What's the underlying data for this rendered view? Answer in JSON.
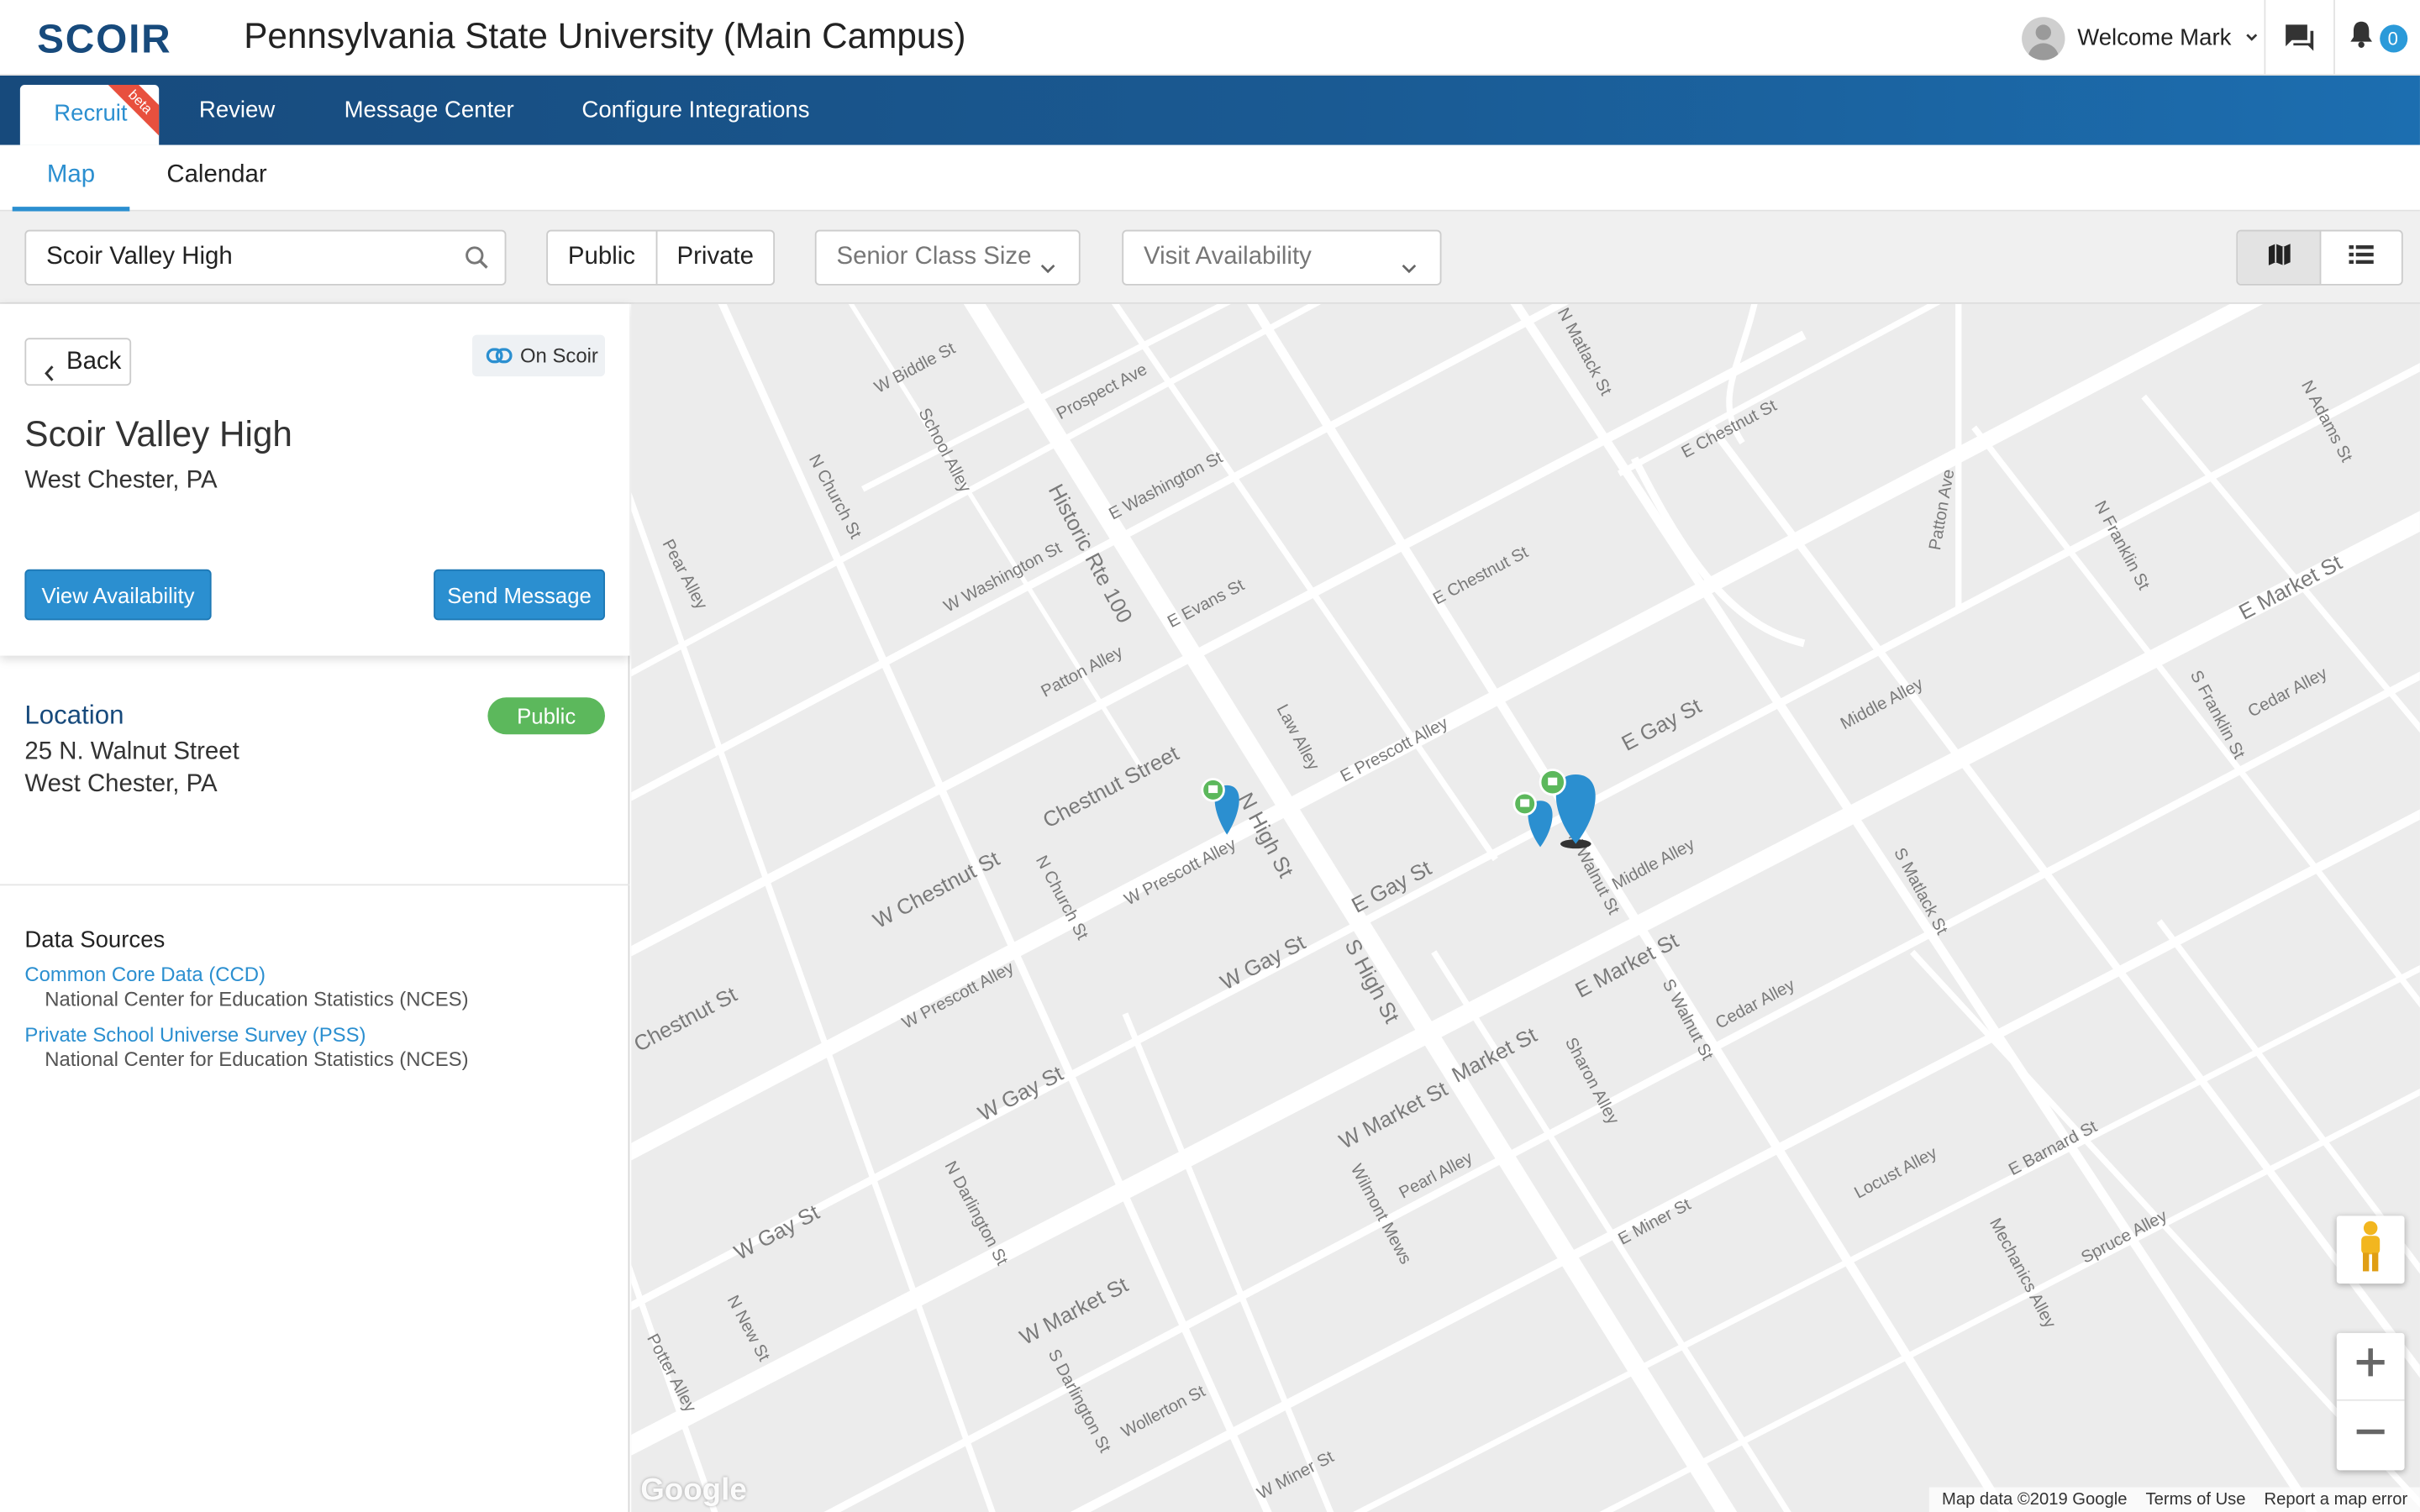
{
  "header": {
    "logo": "SCOIR",
    "institution": "Pennsylvania State University (Main Campus)",
    "welcome": "Welcome Mark",
    "notification_count": "0"
  },
  "nav": {
    "tabs": [
      {
        "label": "Recruit",
        "badge": "beta",
        "active": true
      },
      {
        "label": "Review"
      },
      {
        "label": "Message Center"
      },
      {
        "label": "Configure Integrations"
      }
    ]
  },
  "subnav": {
    "tabs": [
      {
        "label": "Map",
        "active": true
      },
      {
        "label": "Calendar"
      }
    ]
  },
  "filters": {
    "search_value": "Scoir Valley High",
    "public_label": "Public",
    "private_label": "Private",
    "senior_class_size": "Senior Class Size",
    "visit_availability": "Visit Availability",
    "view_modes": [
      "map-icon",
      "list-icon"
    ],
    "selected_view": "map"
  },
  "school": {
    "back_label": "Back",
    "on_scoir_label": "On Scoir",
    "name": "Scoir Valley High",
    "city_state": "West Chester, PA",
    "view_availability_label": "View Availability",
    "send_message_label": "Send Message",
    "location_heading": "Location",
    "type_badge": "Public",
    "address_line1": "25 N. Walnut Street",
    "address_line2": "West Chester, PA"
  },
  "data_sources": {
    "heading": "Data Sources",
    "items": [
      {
        "name": "Common Core Data (CCD)",
        "source": "National Center for Education Statistics (NCES)"
      },
      {
        "name": "Private School Universe Survey (PSS)",
        "source": "National Center for Education Statistics (NCES)"
      }
    ]
  },
  "map": {
    "attribution": "Map data ©2019 Google",
    "terms": "Terms of Use",
    "report": "Report a map error",
    "google": "Google",
    "street_labels": [
      "Historic Rte 100",
      "Chestnut Street",
      "W Chestnut St",
      "E Gay St",
      "W Gay St",
      "E Market St",
      "W Market St",
      "Market St",
      "N High St",
      "S High St",
      "E Gay St",
      "E Market St",
      "W Washington St",
      "E Washington St",
      "E Evans St",
      "E Chestnut St",
      "E Chestnut St",
      "Prospect Ave",
      "Patton Alley",
      "Law Alley",
      "E Prescott Alley",
      "W Prescott Alley",
      "W Prescott Alley",
      "N Church St",
      "N Church St",
      "School Alley",
      "Pear Alley",
      "N Matlack St",
      "S Matlack St",
      "N Walnut St",
      "S Walnut St",
      "Middle Alley",
      "Middle Alley",
      "Cedar Alley",
      "Cedar Alley",
      "Sharon Alley",
      "Wilmont Mews",
      "Pearl Alley",
      "E Miner St",
      "W Miner St",
      "N Darlington St",
      "S Darlington St",
      "N New St",
      "Locust Alley",
      "Mechanics Alley",
      "Spruce Alley",
      "E Barnard St",
      "Wollerton St",
      "Potter Alley",
      "N Franklin St",
      "S Franklin St",
      "N Adams St",
      "Patton Ave",
      "W Biddle St",
      "Chestnut St",
      "W Gay St",
      "W Market St",
      "N Darlington St",
      "W Washington St"
    ]
  }
}
